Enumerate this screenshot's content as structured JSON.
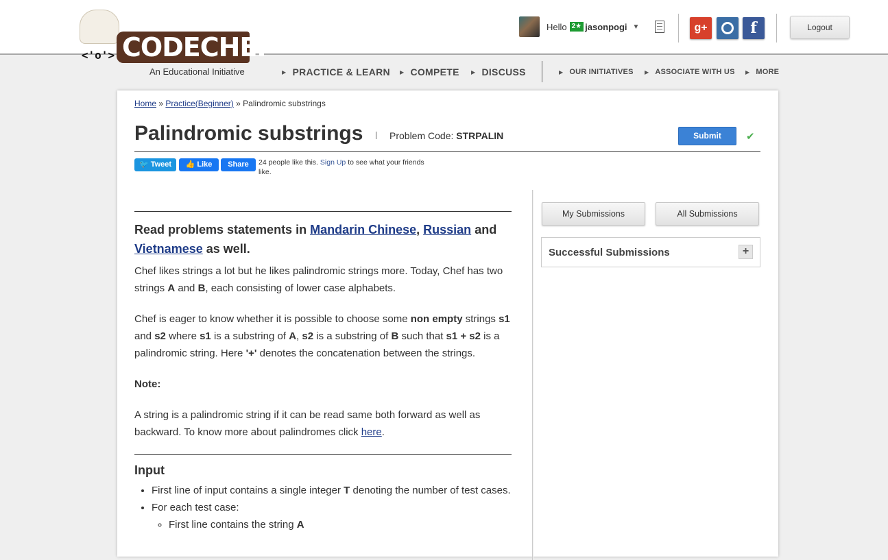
{
  "brand": {
    "logo_text": "CODECHEF",
    "tagline": "An Educational Initiative",
    "face": "<'o'>"
  },
  "user": {
    "greeting": "Hello",
    "star_badge": "2★",
    "username": "jasonpogi",
    "logout_label": "Logout"
  },
  "social": {
    "gplus": "g+",
    "github": "",
    "facebook": "f"
  },
  "nav": {
    "main": [
      "PRACTICE & LEARN",
      "COMPETE",
      "DISCUSS"
    ],
    "secondary": [
      "OUR INITIATIVES",
      "ASSOCIATE WITH US",
      "MORE"
    ]
  },
  "breadcrumb": {
    "home": "Home",
    "sep1": "»",
    "practice": "Practice(Beginner)",
    "sep2": "»",
    "current": "Palindromic substrings"
  },
  "problem": {
    "title": "Palindromic substrings",
    "code_label": "Problem Code:",
    "code": "STRPALIN",
    "submit_label": "Submit",
    "solved_mark": "✔"
  },
  "share": {
    "tweet": "Tweet",
    "like": "Like",
    "share": "Share",
    "likes_text": "24 people like this.",
    "signup": "Sign Up",
    "likes_tail": "to see what your friends like."
  },
  "statement": {
    "lang_prefix": "Read problems statements in",
    "lang1": "Mandarin Chinese",
    "comma": ",",
    "lang2": "Russian",
    "and": "and",
    "lang3": "Vietnamese",
    "lang_suffix": "as well.",
    "p1a": "Chef likes strings a lot but he likes palindromic strings more. Today, Chef has two strings",
    "A": "A",
    "and_word": "and",
    "B": "B",
    "p1b": ", each consisting of lower case alphabets.",
    "p2a": "Chef is eager to know whether it is possible to choose some",
    "non_empty": "non empty",
    "p2b": "strings",
    "s1": "s1",
    "s2": "s2",
    "where": "where",
    "is_sub_of": "is a substring of",
    "such_that": "such that",
    "s1_plus_s2": "s1 + s2",
    "p2c": "is a palindromic string. Here",
    "plus_quote": "'+'",
    "p2d": "denotes the concatenation between the strings.",
    "note_label": "Note:",
    "p3": "A string is a palindromic string if it can be read same both forward as well as backward. To know more about palindromes click",
    "here": "here",
    "period": "."
  },
  "input": {
    "heading": "Input",
    "li1a": "First line of input contains a single integer",
    "T": "T",
    "li1b": "denoting the number of test cases.",
    "li2": "For each test case:",
    "li2_1a": "First line contains the string",
    "li2_1b": "A"
  },
  "sidebar": {
    "my_submissions": "My Submissions",
    "all_submissions": "All Submissions",
    "successful": "Successful Submissions",
    "expand": "+"
  }
}
